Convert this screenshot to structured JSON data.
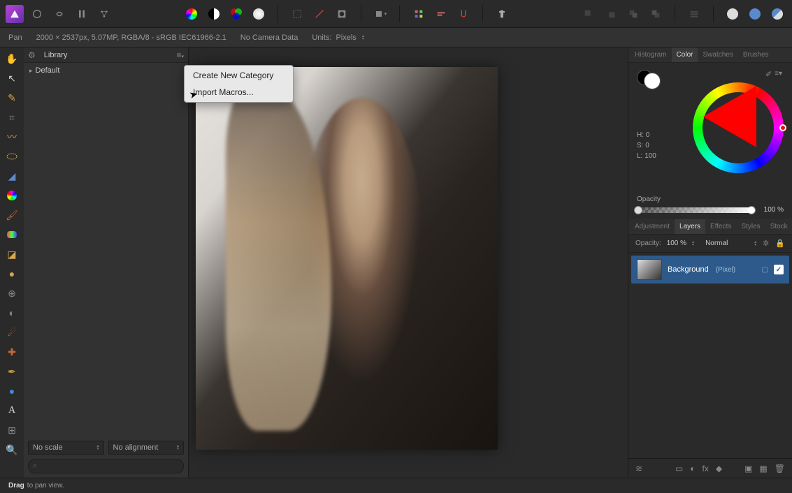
{
  "context_bar": {
    "tool": "Pan",
    "doc_info": "2000 × 2537px, 5.07MP, RGBA/8 - sRGB IEC61966-2.1",
    "camera": "No Camera Data",
    "units_label": "Units:",
    "units_value": "Pixels"
  },
  "library_panel": {
    "title": "Library",
    "default_item": "Default",
    "no_scale": "No scale",
    "no_alignment": "No alignment",
    "search_placeholder": ""
  },
  "context_menu": {
    "create_category": "Create New Category",
    "import_macros": "Import Macros..."
  },
  "color_panel": {
    "tabs": {
      "histogram": "Histogram",
      "color": "Color",
      "swatches": "Swatches",
      "brushes": "Brushes"
    },
    "hsl": {
      "h": "H: 0",
      "s": "S: 0",
      "l": "L: 100"
    },
    "opacity_label": "Opacity",
    "opacity_value": "100 %"
  },
  "layers_panel": {
    "tabs": {
      "adjustment": "Adjustment",
      "layers": "Layers",
      "effects": "Effects",
      "styles": "Styles",
      "stock": "Stock"
    },
    "opacity_label": "Opacity:",
    "opacity_value": "100 %",
    "blend_mode": "Normal",
    "layer": {
      "name": "Background",
      "type": "(Pixel)"
    }
  },
  "status_bar": {
    "drag": "Drag",
    "hint": "to pan view."
  }
}
